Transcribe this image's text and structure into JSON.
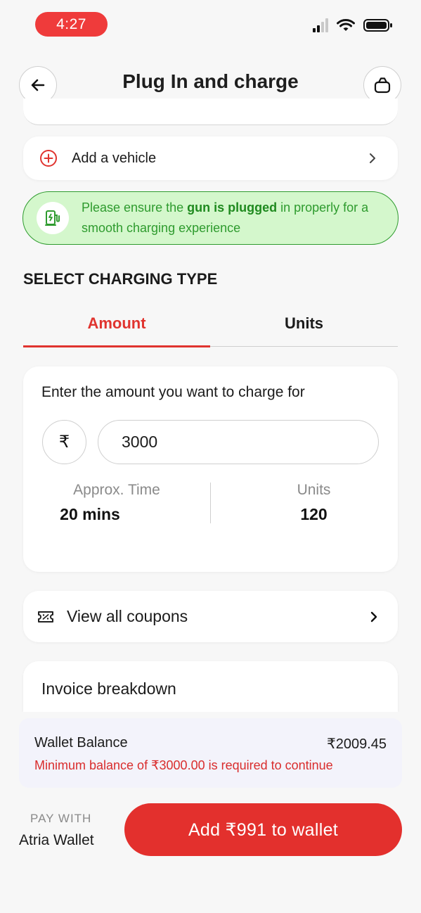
{
  "status_bar": {
    "time": "4:27"
  },
  "header": {
    "title": "Plug In and charge",
    "back_icon": "arrow-left-icon",
    "cart_icon": "bag-icon"
  },
  "vehicle": {
    "label": "Add a vehicle"
  },
  "banner": {
    "text_before": "Please ensure the ",
    "text_bold": "gun is plugged",
    "text_after": " in properly for a smooth charging experience"
  },
  "charging_type": {
    "title": "SELECT CHARGING TYPE",
    "tabs": [
      {
        "label": "Amount",
        "active": true
      },
      {
        "label": "Units",
        "active": false
      }
    ]
  },
  "amount_card": {
    "prompt": "Enter the amount you want to charge for",
    "currency_symbol": "₹",
    "amount_value": "3000",
    "time_label": "Approx. Time",
    "time_value": "20 mins",
    "units_label": "Units",
    "units_value": "120"
  },
  "coupons": {
    "label": "View all coupons"
  },
  "invoice": {
    "title": "Invoice breakdown"
  },
  "wallet": {
    "label": "Wallet Balance",
    "balance": "₹2009.45",
    "warning": "Minimum balance of ₹3000.00 is required to continue"
  },
  "payment": {
    "pay_with_label": "PAY WITH",
    "method": "Atria Wallet",
    "cta_label": "Add ₹991 to wallet"
  },
  "colors": {
    "accent": "#e3302d",
    "success": "#2e9b2e",
    "success_bg": "#d4f7cc"
  }
}
